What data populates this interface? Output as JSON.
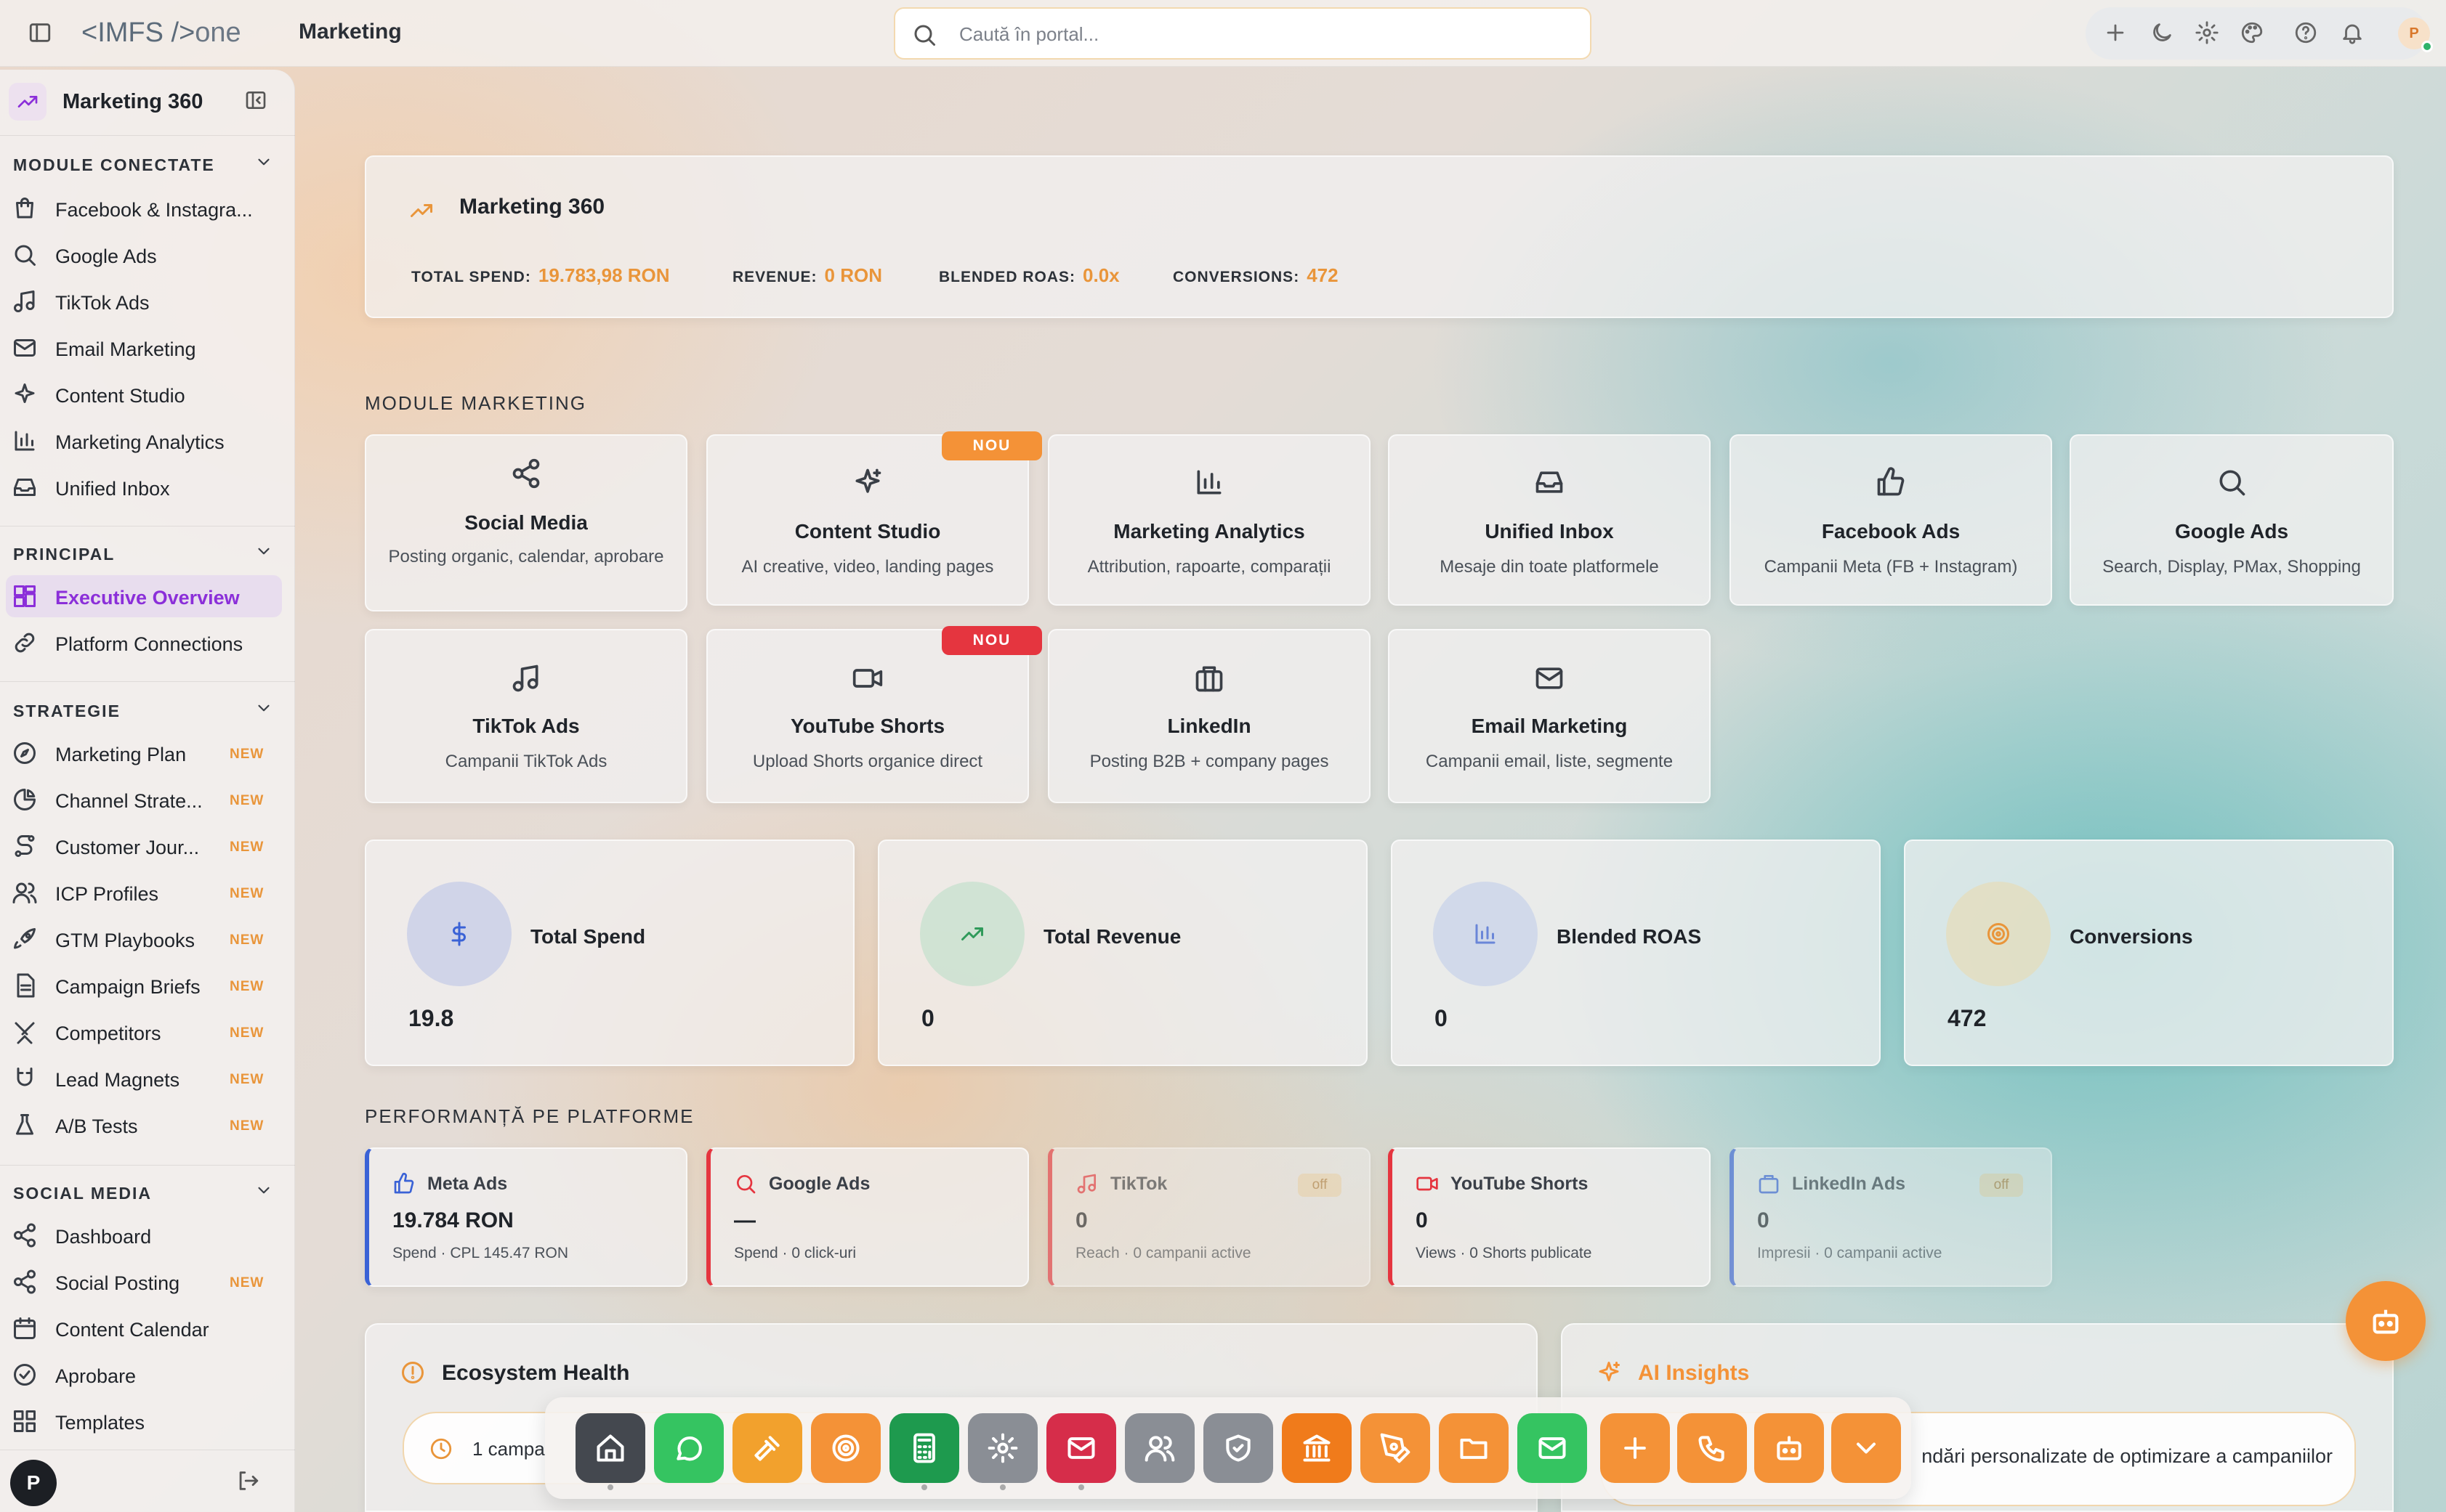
{
  "header": {
    "logo_a": "<IMFS",
    "logo_b": "/>",
    "logo_c": "one",
    "title": "Marketing",
    "search_placeholder": "Caută în portal...",
    "avatar": "P"
  },
  "sidebar": {
    "app_title": "Marketing 360",
    "sections": [
      {
        "title": "MODULE CONECTATE",
        "items": [
          {
            "label": "Facebook & Instagra...",
            "icon": "shopping-bag-icon"
          },
          {
            "label": "Google Ads",
            "icon": "search-icon"
          },
          {
            "label": "TikTok Ads",
            "icon": "music-icon"
          },
          {
            "label": "Email Marketing",
            "icon": "mail-icon"
          },
          {
            "label": "Content Studio",
            "icon": "sparkles-icon"
          },
          {
            "label": "Marketing Analytics",
            "icon": "bar-chart-icon"
          },
          {
            "label": "Unified Inbox",
            "icon": "inbox-icon"
          }
        ]
      },
      {
        "title": "PRINCIPAL",
        "items": [
          {
            "label": "Executive Overview",
            "icon": "dashboard-icon",
            "active": true
          },
          {
            "label": "Platform Connections",
            "icon": "link-icon"
          }
        ]
      },
      {
        "title": "STRATEGIE",
        "items": [
          {
            "label": "Marketing Plan",
            "icon": "compass-icon",
            "badge": "NEW"
          },
          {
            "label": "Channel Strate...",
            "icon": "pie-chart-icon",
            "badge": "NEW"
          },
          {
            "label": "Customer Jour...",
            "icon": "route-icon",
            "badge": "NEW"
          },
          {
            "label": "ICP Profiles",
            "icon": "users-icon",
            "badge": "NEW"
          },
          {
            "label": "GTM Playbooks",
            "icon": "rocket-icon",
            "badge": "NEW"
          },
          {
            "label": "Campaign Briefs",
            "icon": "file-text-icon",
            "badge": "NEW"
          },
          {
            "label": "Competitors",
            "icon": "swords-icon",
            "badge": "NEW"
          },
          {
            "label": "Lead Magnets",
            "icon": "magnet-icon",
            "badge": "NEW"
          },
          {
            "label": "A/B Tests",
            "icon": "flask-icon",
            "badge": "NEW"
          }
        ]
      },
      {
        "title": "SOCIAL MEDIA",
        "items": [
          {
            "label": "Dashboard",
            "icon": "share-icon"
          },
          {
            "label": "Social Posting",
            "icon": "share-icon",
            "badge": "NEW"
          },
          {
            "label": "Content Calendar",
            "icon": "calendar-icon"
          },
          {
            "label": "Aprobare",
            "icon": "check-circle-icon"
          },
          {
            "label": "Templates",
            "icon": "grid-icon"
          }
        ]
      }
    ],
    "user_avatar": "P"
  },
  "hero": {
    "title": "Marketing 360",
    "kpis": [
      {
        "label": "TOTAL SPEND:",
        "value": "19.783,98 RON"
      },
      {
        "label": "REVENUE:",
        "value": "0 RON"
      },
      {
        "label": "BLENDED ROAS:",
        "value": "0.0x"
      },
      {
        "label": "CONVERSIONS:",
        "value": "472"
      }
    ]
  },
  "modules": {
    "title": "MODULE MARKETING",
    "items": [
      {
        "title": "Social Media",
        "desc": "Posting organic, calendar, aprobare",
        "icon": "share-icon"
      },
      {
        "title": "Content Studio",
        "desc": "AI creative, video, landing pages",
        "icon": "sparkles-icon",
        "badge": "NOU",
        "badge_color": "#f49237"
      },
      {
        "title": "Marketing Analytics",
        "desc": "Attribution, rapoarte, comparații",
        "icon": "bar-chart-icon"
      },
      {
        "title": "Unified Inbox",
        "desc": "Mesaje din toate platformele",
        "icon": "inbox-icon"
      },
      {
        "title": "Facebook Ads",
        "desc": "Campanii Meta (FB + Instagram)",
        "icon": "thumbs-up-icon"
      },
      {
        "title": "Google Ads",
        "desc": "Search, Display, PMax, Shopping",
        "icon": "search-icon"
      },
      {
        "title": "TikTok Ads",
        "desc": "Campanii TikTok Ads",
        "icon": "music-icon"
      },
      {
        "title": "YouTube Shorts",
        "desc": "Upload Shorts organice direct",
        "icon": "video-icon",
        "badge": "NOU",
        "badge_color": "#e5353f"
      },
      {
        "title": "LinkedIn",
        "desc": "Posting B2B + company pages",
        "icon": "briefcase-icon"
      },
      {
        "title": "Email Marketing",
        "desc": "Campanii email, liste, segmente",
        "icon": "mail-icon"
      }
    ]
  },
  "stats": [
    {
      "title": "Total Spend",
      "value": "19.8",
      "icon": "dollar-icon",
      "color": "#3a62d6"
    },
    {
      "title": "Total Revenue",
      "value": "0",
      "icon": "trending-up-icon",
      "color": "#2f9a5a"
    },
    {
      "title": "Blended ROAS",
      "value": "0",
      "icon": "bar-chart-icon",
      "color": "#6a86d8"
    },
    {
      "title": "Conversions",
      "value": "472",
      "icon": "target-icon",
      "color": "#e9953a"
    }
  ],
  "platforms": {
    "title": "PERFORMANȚĂ PE PLATFORME",
    "items": [
      {
        "name": "Meta Ads",
        "value": "19.784 RON",
        "sub": "Spend · CPL 145.47 RON",
        "color": "#3a62d6",
        "icon": "thumbs-up-icon"
      },
      {
        "name": "Google Ads",
        "value": "—",
        "sub": "Spend · 0 click-uri",
        "color": "#e5353f",
        "icon": "search-icon"
      },
      {
        "name": "TikTok",
        "value": "0",
        "sub": "Reach · 0 campanii active",
        "color": "#e5353f",
        "icon": "music-icon",
        "status": "off"
      },
      {
        "name": "YouTube Shorts",
        "value": "0",
        "sub": "Views · 0 Shorts publicate",
        "color": "#e5353f",
        "icon": "video-icon"
      },
      {
        "name": "LinkedIn Ads",
        "value": "0",
        "sub": "Impresii · 0 campanii active",
        "color": "#3a62d6",
        "icon": "briefcase-icon",
        "status": "off"
      }
    ]
  },
  "ecosystem": {
    "title": "Ecosystem Health",
    "pill": "1 campa"
  },
  "ai": {
    "title": "AI Insights",
    "pill": "ndări personalizate de optimizare a campaniilor"
  },
  "dock": [
    {
      "name": "home",
      "color": "#44484f"
    },
    {
      "name": "whatsapp",
      "color": "#35c461"
    },
    {
      "name": "gavel",
      "color": "#f2a12d"
    },
    {
      "name": "target",
      "color": "#f49237"
    },
    {
      "name": "calculator",
      "color": "#1e9a4e"
    },
    {
      "name": "settings",
      "color": "#8a8e95"
    },
    {
      "name": "mail",
      "color": "#d62d4a"
    },
    {
      "name": "users",
      "color": "#8a8e95"
    },
    {
      "name": "shield",
      "color": "#8a8e95"
    },
    {
      "name": "bank",
      "color": "#f07b1b"
    },
    {
      "name": "pen",
      "color": "#f49237"
    },
    {
      "name": "folder",
      "color": "#f49237"
    },
    {
      "name": "email",
      "color": "#35c461"
    },
    {
      "name": "plus",
      "color": "#f49237"
    },
    {
      "name": "phone",
      "color": "#f49237"
    },
    {
      "name": "robot",
      "color": "#f49237"
    },
    {
      "name": "chevron-down",
      "color": "#f49237"
    }
  ]
}
